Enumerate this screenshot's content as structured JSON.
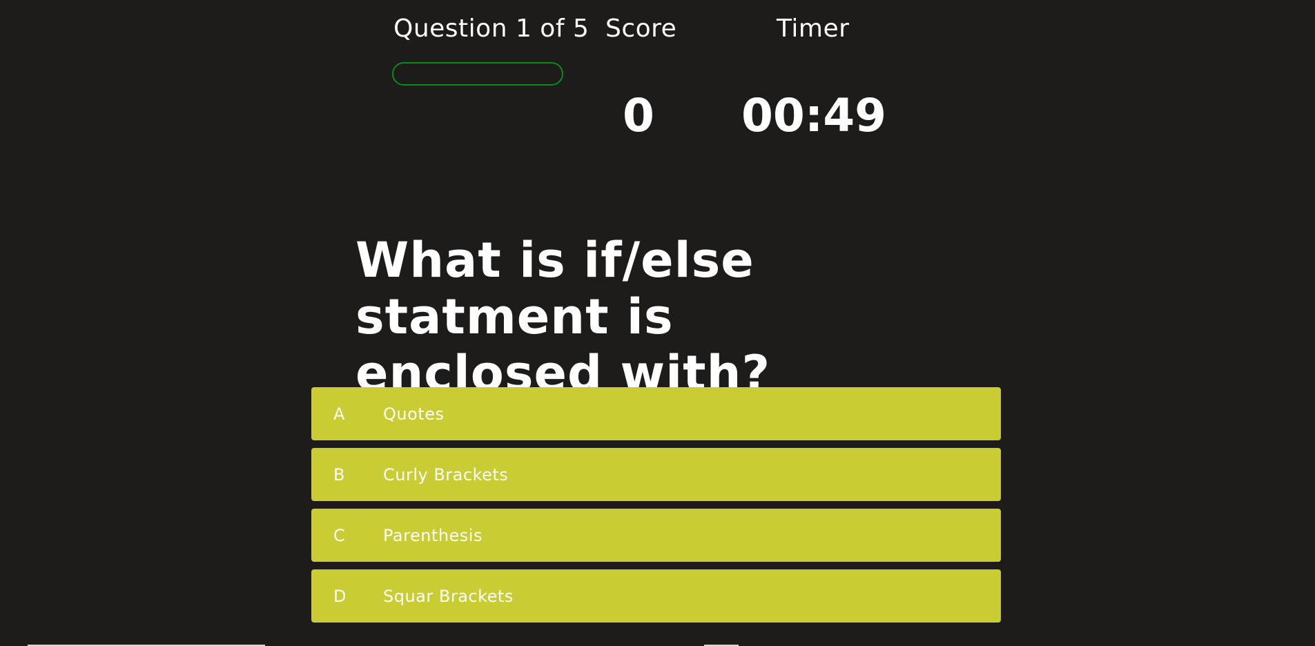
{
  "hud": {
    "question_counter": "Question 1 of 5",
    "score_label": "Score",
    "timer_label": "Timer",
    "score_value": "0",
    "timer_value": "00:49",
    "progress_fraction": 0
  },
  "question": {
    "text": "What is if/else statment is enclosed with?"
  },
  "answers": [
    {
      "letter": "A",
      "text": "Quotes"
    },
    {
      "letter": "B",
      "text": "Curly Brackets"
    },
    {
      "letter": "C",
      "text": "Parenthesis"
    },
    {
      "letter": "D",
      "text": "Squar Brackets"
    }
  ],
  "colors": {
    "background": "#1d1c1b",
    "answer_bg": "#c9cc33",
    "progress_border": "#0c8a1e",
    "text": "#ffffff"
  }
}
